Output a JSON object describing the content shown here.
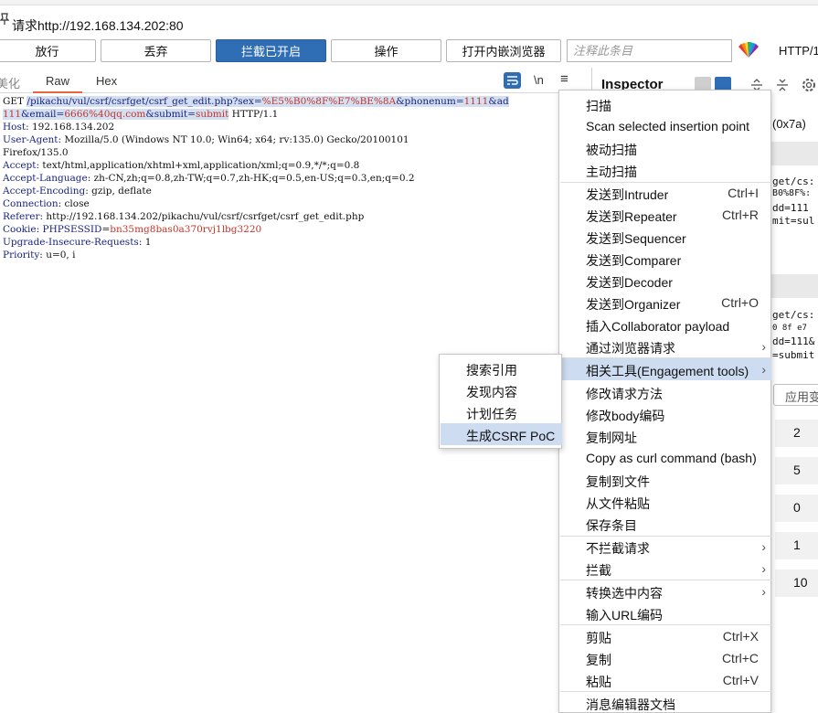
{
  "window": {
    "title": "请求http://192.168.134.202:80"
  },
  "toolbar": {
    "forward": "放行",
    "drop": "丢弃",
    "intercept": "拦截已开启",
    "action": "操作",
    "open_browser": "打开内嵌浏览器",
    "comment_placeholder": "注释此条目",
    "http_label": "HTTP/1"
  },
  "editor": {
    "tabs": {
      "pretty": "美化",
      "raw": "Raw",
      "hex": "Hex"
    },
    "newline_label": "\\n",
    "menu_glyph": "≡",
    "request": {
      "method": "GET",
      "path": "/pikachu/vul/csrf/csrfget/csrf_get_edit.php?",
      "params_line1": [
        {
          "name": "sex",
          "eq": "=",
          "value": "%E5%B0%8F%E7%BE%8A"
        },
        {
          "name": "&phonenum",
          "eq": "=",
          "value": "1111"
        },
        {
          "name": "&ad",
          "eq": "",
          "value": ""
        }
      ],
      "params_line2": [
        {
          "name": "",
          "eq": "",
          "value": "111"
        },
        {
          "name": "&email",
          "eq": "=",
          "value": "6666%40qq.com"
        },
        {
          "name": "&submit",
          "eq": "=",
          "value": "submit"
        }
      ],
      "http_version": " HTTP/1.1",
      "headers": [
        {
          "name": "Host",
          "value": "192.168.134.202"
        },
        {
          "name": "User-Agent",
          "value": "Mozilla/5.0 (Windows NT 10.0; Win64; x64; rv:135.0) Gecko/20100101"
        },
        {
          "name": "",
          "value": "Firefox/135.0"
        },
        {
          "name": "Accept",
          "value": "text/html,application/xhtml+xml,application/xml;q=0.9,*/*;q=0.8"
        },
        {
          "name": "Accept-Language",
          "value": "zh-CN,zh;q=0.8,zh-TW;q=0.7,zh-HK;q=0.5,en-US;q=0.3,en;q=0.2"
        },
        {
          "name": "Accept-Encoding",
          "value": "gzip, deflate"
        },
        {
          "name": "Connection",
          "value": "close"
        },
        {
          "name": "Referer",
          "value": "http://192.168.134.202/pikachu/vul/csrf/csrfget/csrf_get_edit.php"
        },
        {
          "name": "Cookie",
          "value": "",
          "cookie_name": "PHPSESSID",
          "cookie_value": "bn35mg8bas0a370rvj1lbg3220"
        },
        {
          "name": "Upgrade-Insecure-Requests",
          "value": "1"
        },
        {
          "name": "Priority",
          "value": "u=0, i"
        }
      ]
    }
  },
  "inspector": {
    "title": "Inspector",
    "fragments": {
      "hex_hint": "(0x7a)",
      "a1": "get/cs:",
      "a2": "B0%8F%:",
      "a3": "dd=111",
      "a4": "mit=sul",
      "b1": "get/cs:",
      "b2": "0 8f e7",
      "b3": "dd=111&",
      "b4": "=submit"
    },
    "apply_label": "应用变",
    "counts": [
      "2",
      "5",
      "0",
      "1",
      "10"
    ]
  },
  "context_menu": {
    "items": [
      {
        "label": "扫描",
        "shortcut": "",
        "arrow": false
      },
      {
        "label": "Scan selected insertion point",
        "shortcut": "",
        "arrow": false
      },
      {
        "label": "被动扫描",
        "shortcut": "",
        "arrow": false
      },
      {
        "label": "主动扫描",
        "shortcut": "",
        "arrow": false
      },
      {
        "label": "发送到Intruder",
        "shortcut": "Ctrl+I",
        "arrow": false
      },
      {
        "label": "发送到Repeater",
        "shortcut": "Ctrl+R",
        "arrow": false
      },
      {
        "label": "发送到Sequencer",
        "shortcut": "",
        "arrow": false
      },
      {
        "label": "发送到Comparer",
        "shortcut": "",
        "arrow": false
      },
      {
        "label": "发送到Decoder",
        "shortcut": "",
        "arrow": false
      },
      {
        "label": "发送到Organizer",
        "shortcut": "Ctrl+O",
        "arrow": false
      },
      {
        "label": "插入Collaborator payload",
        "shortcut": "",
        "arrow": false
      },
      {
        "label": "通过浏览器请求",
        "shortcut": "",
        "arrow": true
      },
      {
        "label": "相关工具(Engagement tools)",
        "shortcut": "",
        "arrow": true,
        "highlighted": true
      },
      {
        "label": "修改请求方法",
        "shortcut": "",
        "arrow": false
      },
      {
        "label": "修改body编码",
        "shortcut": "",
        "arrow": false
      },
      {
        "label": "复制网址",
        "shortcut": "",
        "arrow": false
      },
      {
        "label": "Copy as curl command (bash)",
        "shortcut": "",
        "arrow": false
      },
      {
        "label": "复制到文件",
        "shortcut": "",
        "arrow": false
      },
      {
        "label": "从文件粘贴",
        "shortcut": "",
        "arrow": false
      },
      {
        "label": "保存条目",
        "shortcut": "",
        "arrow": false
      },
      {
        "label": "不拦截请求",
        "shortcut": "",
        "arrow": true
      },
      {
        "label": "拦截",
        "shortcut": "",
        "arrow": true
      },
      {
        "label": "转换选中内容",
        "shortcut": "",
        "arrow": true
      },
      {
        "label": "输入URL编码",
        "shortcut": "",
        "arrow": false
      },
      {
        "label": "剪贴",
        "shortcut": "Ctrl+X",
        "arrow": false
      },
      {
        "label": "复制",
        "shortcut": "Ctrl+C",
        "arrow": false
      },
      {
        "label": "粘贴",
        "shortcut": "Ctrl+V",
        "arrow": false
      },
      {
        "label": "消息编辑器文档",
        "shortcut": "",
        "arrow": false
      }
    ]
  },
  "submenu": {
    "items": [
      {
        "label": "搜索引用"
      },
      {
        "label": "发现内容"
      },
      {
        "label": "计划任务"
      },
      {
        "label": "生成CSRF PoC",
        "highlighted": true
      }
    ]
  },
  "colors": {
    "accent_blue": "#2f6db5",
    "tab_underline": "#e8663d",
    "menu_highlight": "#cddcf0",
    "header_name": "#1a237e",
    "param_value": "#c0362c"
  }
}
